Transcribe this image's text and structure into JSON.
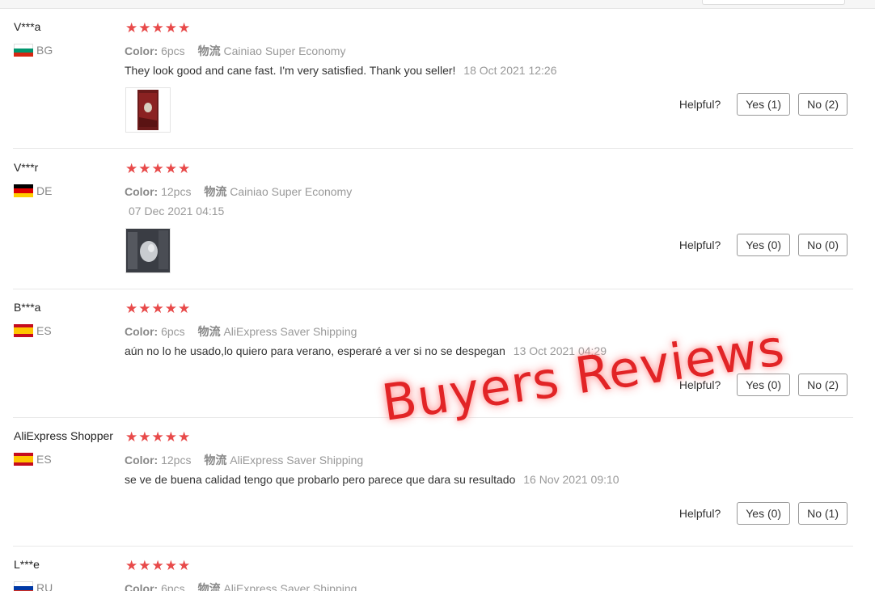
{
  "overlay_text": "Buyers Reviews",
  "helpful_label": "Helpful?",
  "color_label": "Color:",
  "shipping_label": "物流",
  "reviews": [
    {
      "user": "V***a",
      "country": "BG",
      "stars": "★★★★★",
      "color": "6pcs",
      "shipping": "Cainiao Super Economy",
      "text": "They look good and cane fast. I'm very satisfied. Thank you seller!",
      "date": "18 Oct 2021 12:26",
      "yes": "Yes (1)",
      "no": "No (2)"
    },
    {
      "user": "V***r",
      "country": "DE",
      "stars": "★★★★★",
      "color": "12pcs",
      "shipping": "Cainiao Super Economy",
      "text": "",
      "date": "07 Dec 2021 04:15",
      "yes": "Yes (0)",
      "no": "No (0)"
    },
    {
      "user": "B***a",
      "country": "ES",
      "stars": "★★★★★",
      "color": "6pcs",
      "shipping": "AliExpress Saver Shipping",
      "text": "aún no lo he usado,lo quiero para verano, esperaré a ver si no se despegan",
      "date": "13 Oct 2021 04:29",
      "yes": "Yes (0)",
      "no": "No (2)"
    },
    {
      "user": "AliExpress Shopper",
      "country": "ES",
      "stars": "★★★★★",
      "color": "12pcs",
      "shipping": "AliExpress Saver Shipping",
      "text": "se ve de buena calidad tengo que probarlo pero parece que dara su resultado",
      "date": "16 Nov 2021 09:10",
      "yes": "Yes (0)",
      "no": "No (1)"
    },
    {
      "user": "L***e",
      "country": "RU",
      "stars": "★★★★★",
      "color": "6pcs",
      "shipping": "AliExpress Saver Shipping"
    }
  ],
  "colors": {
    "star": "#e84a4a",
    "overlay": "#e22426"
  }
}
